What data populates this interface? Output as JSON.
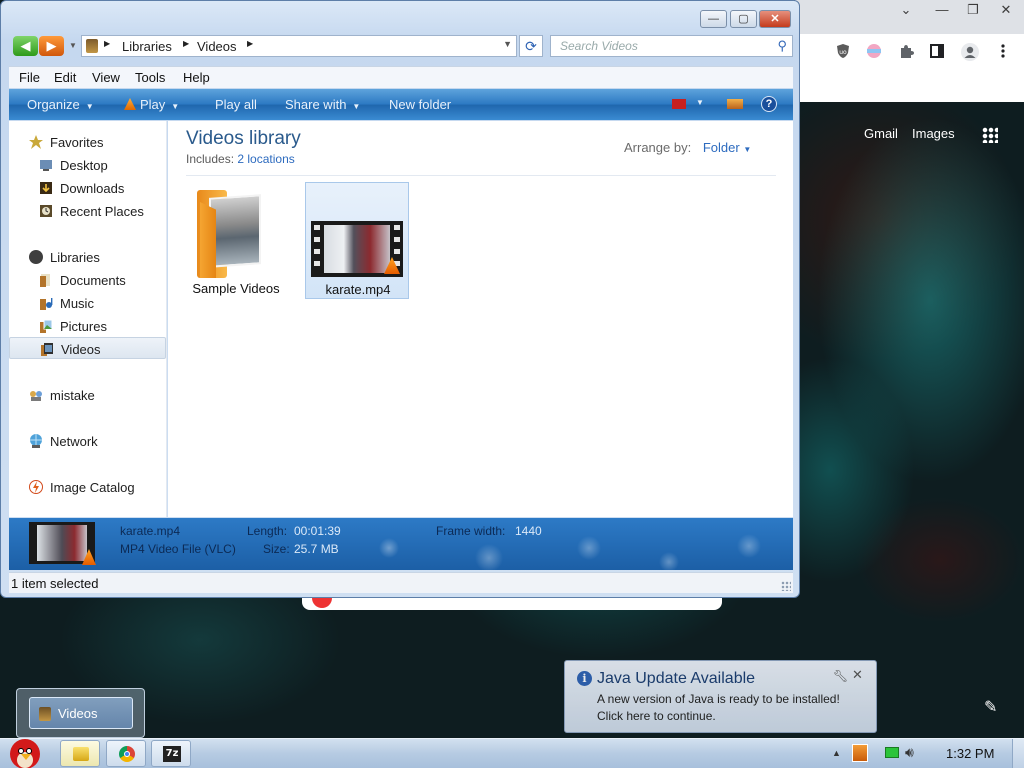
{
  "browser": {
    "window_controls": {
      "minimize": "—",
      "restore": "❐",
      "close": "✕"
    },
    "tab_dropdown": "⌄",
    "toolbar_icons": [
      "extension-ublock-icon",
      "extension-color-icon",
      "puzzle-icon",
      "sidebar-icon",
      "profile-icon",
      "kebab-menu-icon"
    ],
    "links": {
      "gmail": "Gmail",
      "images": "Images"
    },
    "edit_glyph": "✎"
  },
  "explorer": {
    "controls": {
      "minimize": "—",
      "maximize": "▢",
      "close": "✕"
    },
    "breadcrumb": [
      "Libraries",
      "Videos"
    ],
    "search_placeholder": "Search Videos",
    "menu": [
      "File",
      "Edit",
      "View",
      "Tools",
      "Help"
    ],
    "commands": {
      "organize": "Organize",
      "play": "Play",
      "play_all": "Play all",
      "share_with": "Share with",
      "new_folder": "New folder",
      "help": "?"
    },
    "nav": {
      "favorites": "Favorites",
      "desktop": "Desktop",
      "downloads": "Downloads",
      "recent_places": "Recent Places",
      "libraries": "Libraries",
      "documents": "Documents",
      "music": "Music",
      "pictures": "Pictures",
      "videos": "Videos",
      "mistake": "mistake",
      "network": "Network",
      "image_catalog": "Image Catalog"
    },
    "library": {
      "title": "Videos library",
      "includes_label": "Includes:",
      "includes_link": "2 locations",
      "arrange_label": "Arrange by:",
      "arrange_value": "Folder"
    },
    "files": [
      {
        "name": "Sample Videos",
        "type": "folder"
      },
      {
        "name": "karate.mp4",
        "type": "video",
        "selected": true
      }
    ],
    "details": {
      "name": "karate.mp4",
      "type": "MP4 Video File (VLC)",
      "length_label": "Length:",
      "length_value": "00:01:39",
      "size_label": "Size:",
      "size_value": "25.7 MB",
      "frame_label": "Frame width:",
      "frame_value": "1440"
    },
    "status": "1 item selected"
  },
  "java_popup": {
    "title": "Java Update Available",
    "line1": "A new version of Java is ready to be installed!",
    "line2": "Click here to continue."
  },
  "taskbar": {
    "preview_label": "Videos",
    "seven_zip": "7z",
    "clock": "1:32 PM"
  }
}
